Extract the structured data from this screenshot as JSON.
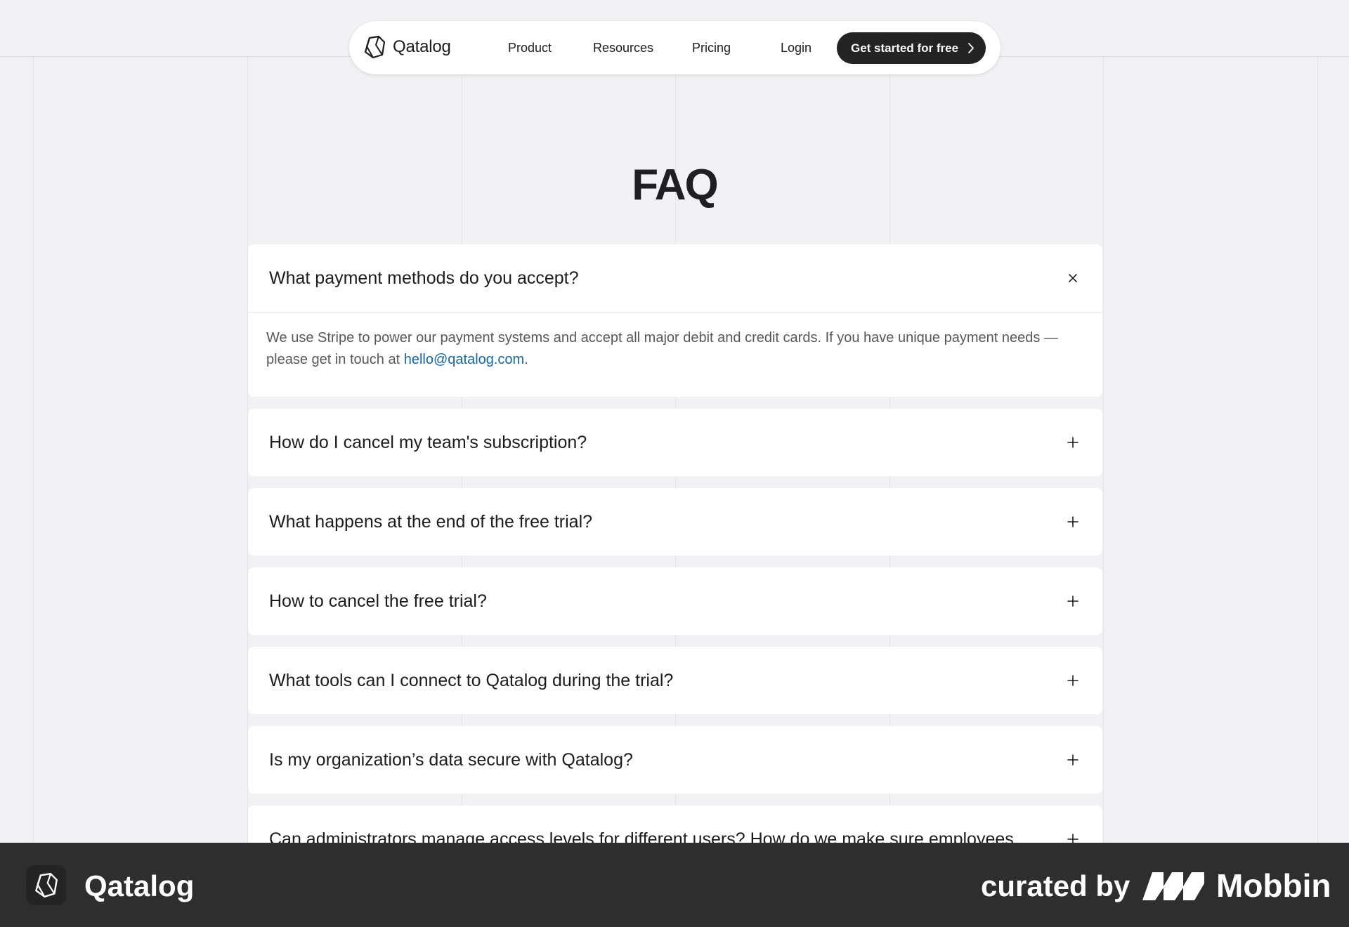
{
  "colors": {
    "background": "#f2f2f4",
    "card": "#ffffff",
    "cta_background": "#232323",
    "link": "#1565a8",
    "banner": "#2e2e2e"
  },
  "navbar": {
    "brand": "Qatalog",
    "brand_icon": "qatalog-logo-icon",
    "links": [
      "Product",
      "Resources",
      "Pricing",
      "Login"
    ],
    "cta_label": "Get started for free",
    "cta_icon": "chevron-right-icon"
  },
  "main": {
    "title": "FAQ",
    "faqs": [
      {
        "question": "What payment methods do you accept?",
        "expanded": true,
        "toggle_icon": "close-icon",
        "answer_text": "We use Stripe to power our payment systems and accept all major debit and credit cards. If you have unique payment needs — please get in touch at ",
        "answer_link": "hello@qatalog.com",
        "answer_end": "."
      },
      {
        "question": "How do I cancel my team's subscription?",
        "expanded": false,
        "toggle_icon": "plus-icon"
      },
      {
        "question": "What happens at the end of the free trial?",
        "expanded": false,
        "toggle_icon": "plus-icon"
      },
      {
        "question": "How to cancel the free trial?",
        "expanded": false,
        "toggle_icon": "plus-icon"
      },
      {
        "question": "What tools can I connect to Qatalog during the trial?",
        "expanded": false,
        "toggle_icon": "plus-icon"
      },
      {
        "question": "Is my organization’s data secure with Qatalog?",
        "expanded": false,
        "toggle_icon": "plus-icon"
      },
      {
        "question": "Can administrators manage access levels for different users? How do we make sure employees",
        "expanded": false,
        "toggle_icon": "plus-icon"
      }
    ]
  },
  "banner": {
    "brand": "Qatalog",
    "curated_by": "curated by",
    "curator": "Mobbin",
    "curator_icon": "mobbin-logo-icon"
  }
}
